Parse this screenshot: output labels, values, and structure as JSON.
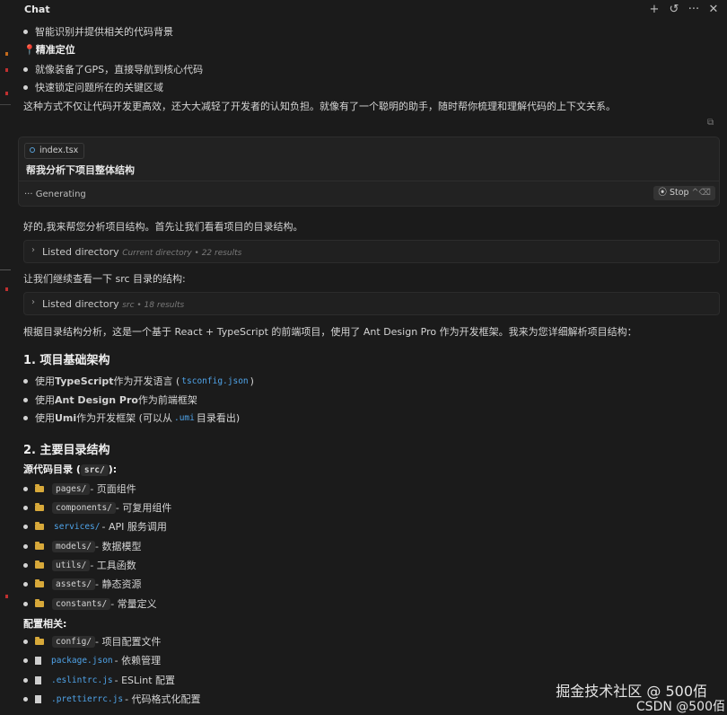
{
  "header": {
    "title": "Chat",
    "icons": [
      "plus-icon",
      "history-icon",
      "more-icon",
      "close-icon"
    ]
  },
  "intro": {
    "bullet1": "智能识别并提供相关的代码背景",
    "precise_heading": "精准定位",
    "bullet2": "就像装备了GPS，直接导航到核心代码",
    "bullet3": "快速锁定问题所在的关键区域",
    "summary": "这种方式不仅让代码开发更高效，还大大减轻了开发者的认知负担。就像有了一个聪明的助手，随时帮你梳理和理解代码的上下文关系。"
  },
  "context": {
    "file_chip": "index.tsx",
    "prompt": "帮我分析下项目整体结构",
    "status": "Generating",
    "stop_label": "Stop",
    "stop_shortcut": "^⌫"
  },
  "response": {
    "p1": "好的,我来帮您分析项目结构。首先让我们看看项目的目录结构。",
    "tool1": {
      "label": "Listed directory",
      "meta": "Current directory • 22 results"
    },
    "p2": "让我们继续查看一下 src 目录的结构:",
    "tool2": {
      "label": "Listed directory",
      "meta": "src • 18 results"
    },
    "p3": "根据目录结构分析，这是一个基于 React + TypeScript 的前端项目，使用了 Ant Design Pro 作为开发框架。我来为您详细解析项目结构：",
    "h1": "1. 项目基础架构",
    "basics": [
      {
        "pre": "使用 ",
        "bold": "TypeScript",
        "mid": " 作为开发语言 (",
        "code": "tsconfig.json",
        "post": ")"
      },
      {
        "pre": "使用 ",
        "bold": "Ant Design Pro",
        "mid": " 作为前端框架",
        "code": "",
        "post": ""
      },
      {
        "pre": "使用 ",
        "bold": "Umi",
        "mid": " 作为开发框架 (可以从 ",
        "code": ".umi",
        "post": " 目录看出)"
      }
    ],
    "h2": "2. 主要目录结构",
    "src_heading": "源代码目录 (",
    "src_code": "src/",
    "src_heading_end": "):",
    "src_items": [
      {
        "code": "pages/",
        "desc": " - 页面组件"
      },
      {
        "code": "components/",
        "desc": " - 可复用组件"
      },
      {
        "code": "services/",
        "desc": " - API 服务调用"
      },
      {
        "code": "models/",
        "desc": " - 数据模型"
      },
      {
        "code": "utils/",
        "desc": " - 工具函数"
      },
      {
        "code": "assets/",
        "desc": " - 静态资源"
      },
      {
        "code": "constants/",
        "desc": " - 常量定义"
      }
    ],
    "config_heading": "配置相关:",
    "config_items": [
      {
        "code": "config/",
        "desc": " - 项目配置文件",
        "icon": "folder-icon"
      },
      {
        "code": "package.json",
        "desc": " - 依赖管理",
        "icon": "file-icon"
      },
      {
        "code": ".eslintrc.js",
        "desc": " - ESLint 配置",
        "icon": "file-icon"
      },
      {
        "code": ".prettierrc.js",
        "desc": " - 代码格式化配置",
        "icon": "file-icon"
      }
    ]
  },
  "watermark": {
    "line1": "掘金技术社区 @ 500佰",
    "line2": "CSDN @500佰"
  }
}
